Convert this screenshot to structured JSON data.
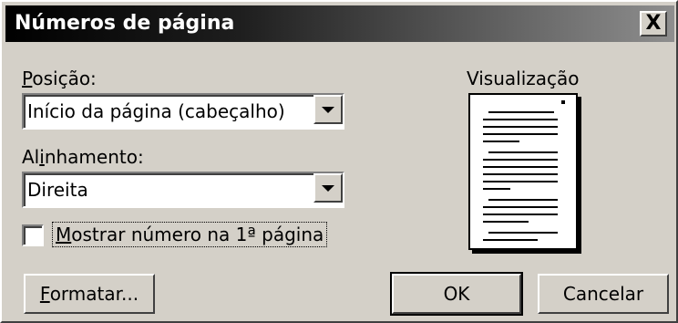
{
  "dialog": {
    "title": "Números de página",
    "close_label": "X"
  },
  "position": {
    "label_mnemonic": "P",
    "label_rest": "osição:",
    "selected": "Início da página (cabeçalho)"
  },
  "alignment": {
    "label_first": "Al",
    "label_mnemonic": "i",
    "label_rest": "nhamento:",
    "selected": "Direita"
  },
  "first_page": {
    "checked": false,
    "label_mnemonic": "M",
    "label_rest": "ostrar número na 1ª página"
  },
  "preview": {
    "label": "Visualização"
  },
  "buttons": {
    "format_mnemonic": "F",
    "format_rest": "ormatar...",
    "ok": "OK",
    "cancel": "Cancelar"
  }
}
